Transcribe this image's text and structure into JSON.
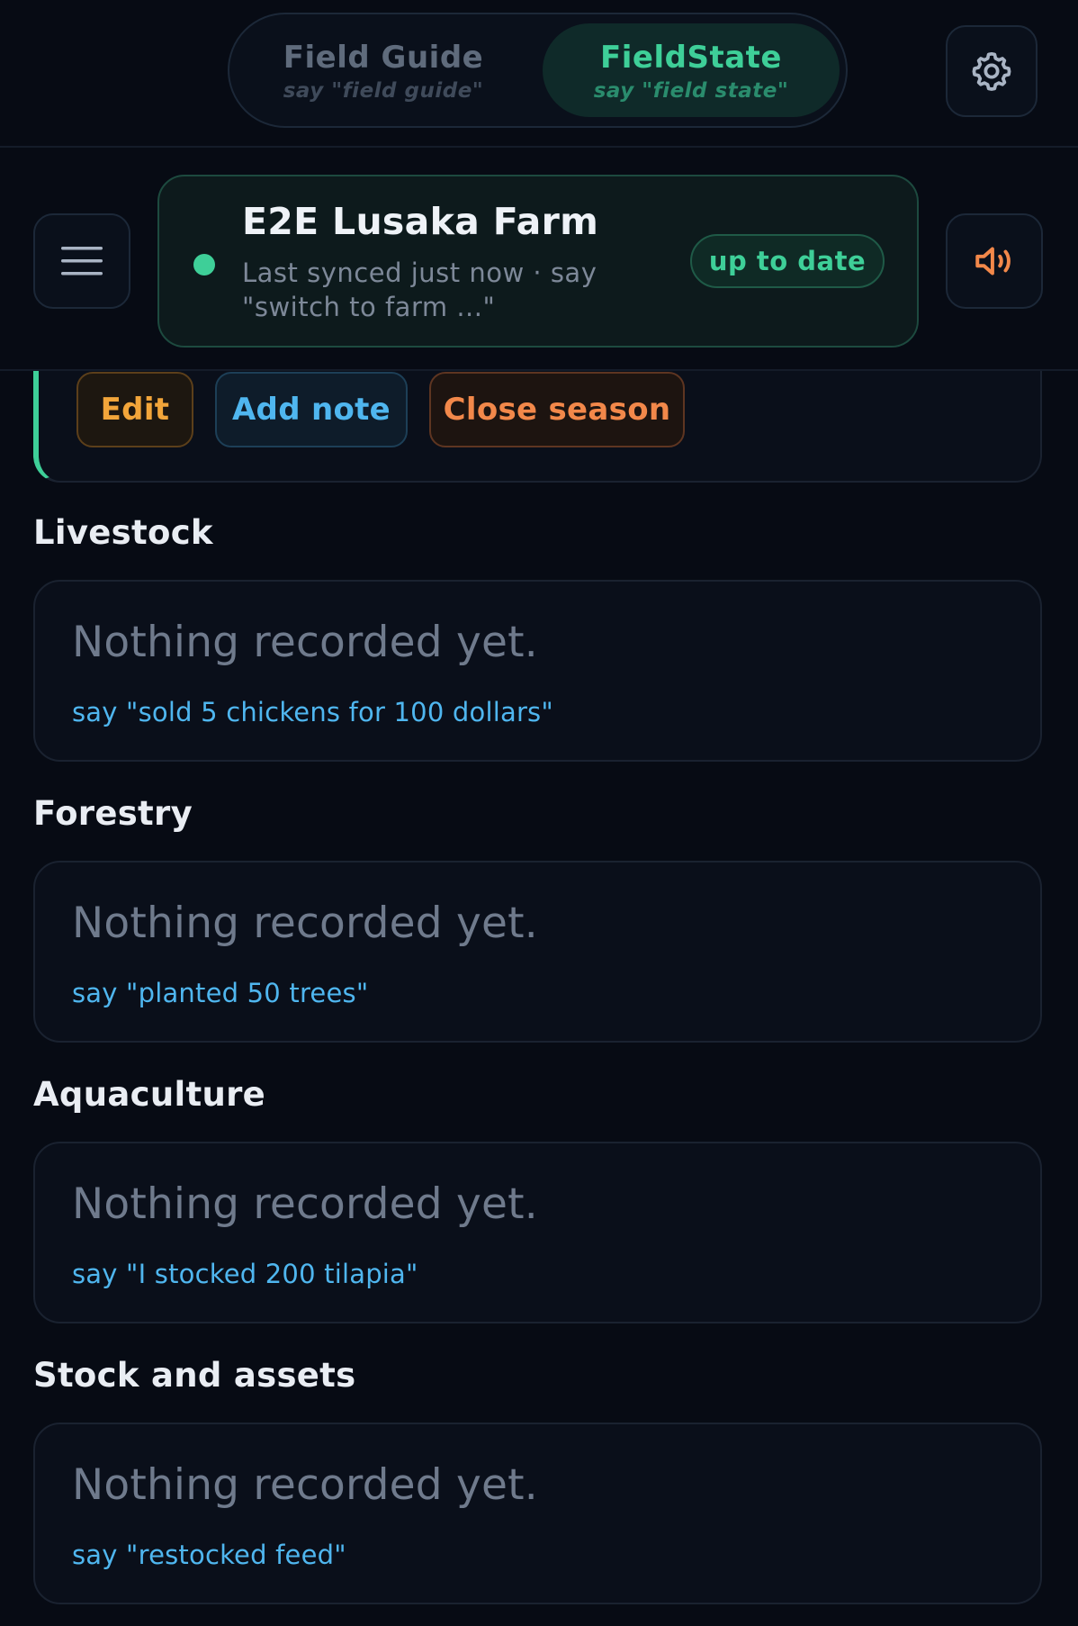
{
  "mode_switch": {
    "tabs": [
      {
        "label": "Field Guide",
        "hint": "say \"field guide\"",
        "active": false
      },
      {
        "label": "FieldState",
        "hint": "say \"field state\"",
        "active": true
      }
    ]
  },
  "icons": {
    "settings": "gear-icon",
    "menu": "hamburger-menu-icon",
    "sound": "speaker-volume-icon",
    "status": "status-dot-icon"
  },
  "farm": {
    "name": "E2E Lusaka Farm",
    "sync_text": "Last synced just now · say \"switch to farm ...\"",
    "sync_status": "up to date"
  },
  "record_actions": {
    "edit_label": "Edit",
    "add_note_label": "Add note",
    "close_season_label": "Close season"
  },
  "sections": [
    {
      "title": "Livestock",
      "empty_text": "Nothing recorded yet.",
      "hint": "say \"sold 5 chickens for 100 dollars\""
    },
    {
      "title": "Forestry",
      "empty_text": "Nothing recorded yet.",
      "hint": "say \"planted 50 trees\""
    },
    {
      "title": "Aquaculture",
      "empty_text": "Nothing recorded yet.",
      "hint": "say \"I stocked 200 tilapia\""
    },
    {
      "title": "Stock and assets",
      "empty_text": "Nothing recorded yet.",
      "hint": "say \"restocked feed\""
    }
  ],
  "colors": {
    "background": "#070b14",
    "accent_green": "#3ecf98",
    "accent_blue": "#4fb6ef",
    "accent_orange": "#f2884a",
    "accent_amber": "#f2a53a"
  }
}
